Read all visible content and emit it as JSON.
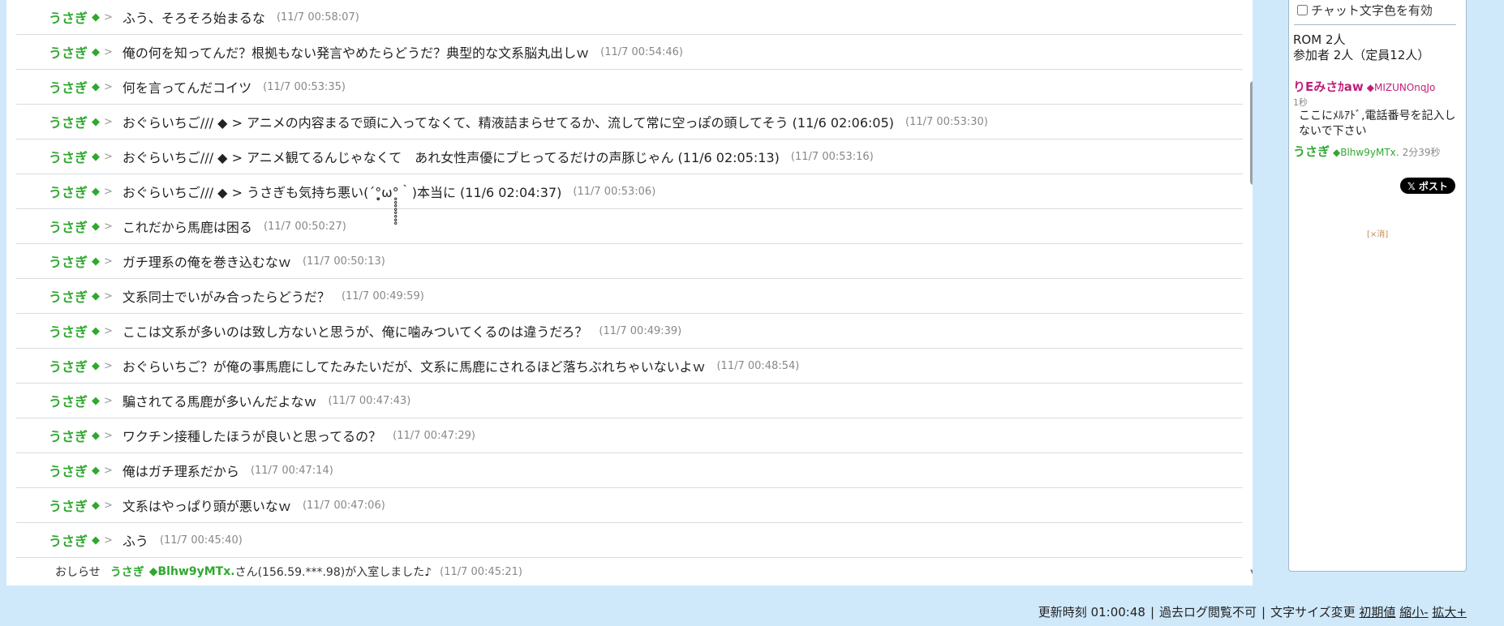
{
  "messages": [
    {
      "name": "うさぎ",
      "trip": "◆",
      "gt": ">",
      "text": "ふう、そろそろ始まるな",
      "time": "(11/7 00:58:07)"
    },
    {
      "name": "うさぎ",
      "trip": "◆",
      "gt": ">",
      "text": "俺の何を知ってんだ？根拠もない発言やめたらどうだ？典型的な文系脳丸出しｗ",
      "time": "(11/7 00:54:46)"
    },
    {
      "name": "うさぎ",
      "trip": "◆",
      "gt": ">",
      "text": "何を言ってんだコイツ",
      "time": "(11/7 00:53:35)"
    },
    {
      "name": "うさぎ",
      "trip": "◆",
      "gt": ">",
      "text": "おぐらいちご/// ◆ > アニメの内容まるで頭に入ってなくて、精液詰まらせてるか、流して常に空っぽの頭してそう (11/6 02:06:05)",
      "time": "(11/7 00:53:30)"
    },
    {
      "name": "うさぎ",
      "trip": "◆",
      "gt": ">",
      "text": "おぐらいちご/// ◆ > アニメ観てるんじゃなくて　あれ女性声優にブヒってるだけの声豚じゃん (11/6 02:05:13)",
      "time": "(11/7 00:53:16)"
    },
    {
      "name": "うさぎ",
      "trip": "◆",
      "gt": ">",
      "text": "おぐらいちご/// ◆ > うさぎも気持ち悪い(´°̥̥̥̥̥̥̥̥ω°̥̥̥̥̥̥̥̥｀)本当に (11/6 02:04:37)",
      "time": "(11/7 00:53:06)"
    },
    {
      "name": "うさぎ",
      "trip": "◆",
      "gt": ">",
      "text": "これだから馬鹿は困る",
      "time": "(11/7 00:50:27)"
    },
    {
      "name": "うさぎ",
      "trip": "◆",
      "gt": ">",
      "text": "ガチ理系の俺を巻き込むなｗ",
      "time": "(11/7 00:50:13)"
    },
    {
      "name": "うさぎ",
      "trip": "◆",
      "gt": ">",
      "text": "文系同士でいがみ合ったらどうだ？",
      "time": "(11/7 00:49:59)"
    },
    {
      "name": "うさぎ",
      "trip": "◆",
      "gt": ">",
      "text": "ここは文系が多いのは致し方ないと思うが、俺に噛みついてくるのは違うだろ？",
      "time": "(11/7 00:49:39)"
    },
    {
      "name": "うさぎ",
      "trip": "◆",
      "gt": ">",
      "text": "おぐらいちご？が俺の事馬鹿にしてたみたいだが、文系に馬鹿にされるほど落ちぶれちゃいないよｗ",
      "time": "(11/7 00:48:54)"
    },
    {
      "name": "うさぎ",
      "trip": "◆",
      "gt": ">",
      "text": "騙されてる馬鹿が多いんだよなｗ",
      "time": "(11/7 00:47:43)"
    },
    {
      "name": "うさぎ",
      "trip": "◆",
      "gt": ">",
      "text": "ワクチン接種したほうが良いと思ってるの？",
      "time": "(11/7 00:47:29)"
    },
    {
      "name": "うさぎ",
      "trip": "◆",
      "gt": ">",
      "text": "俺はガチ理系だから",
      "time": "(11/7 00:47:14)"
    },
    {
      "name": "うさぎ",
      "trip": "◆",
      "gt": ">",
      "text": "文系はやっぱり頭が悪いなｗ",
      "time": "(11/7 00:47:06)"
    },
    {
      "name": "うさぎ",
      "trip": "◆",
      "gt": ">",
      "text": "ふう",
      "time": "(11/7 00:45:40)"
    }
  ],
  "notice": {
    "label": "おしらせ",
    "name": "うさぎ",
    "trip": "◆Blhw9yMTx.",
    "text": "さん(156.59.***.98)が入室しました♪",
    "time": "(11/7 00:45:21)"
  },
  "side": {
    "color_label": "チャット文字色を有効",
    "rom": "ROM 2人",
    "participants": "参加者 2人（定員12人）",
    "user1": {
      "name": "りEみさｶaw",
      "trip": "◆MIZUNOnqJo",
      "time": "1秒",
      "message": "ここにﾒﾙｱﾄﾞ,電話番号を記入しないで下さい"
    },
    "user2": {
      "name": "うさぎ",
      "trip": "◆Blhw9yMTx.",
      "age": "2分39秒"
    },
    "post_button": "𝕏 ポスト",
    "ad_close": "[×消]"
  },
  "footer": {
    "update": "更新時刻 01:00:48",
    "past_log": "過去ログ閲覧不可",
    "font_size": "文字サイズ変更",
    "reset": "初期値",
    "shrink": "縮小-",
    "enlarge": "拡大+"
  },
  "colors": {
    "name_green": "#2fa82f",
    "name_pink": "#c0207a",
    "background": "#cfe9fb"
  }
}
